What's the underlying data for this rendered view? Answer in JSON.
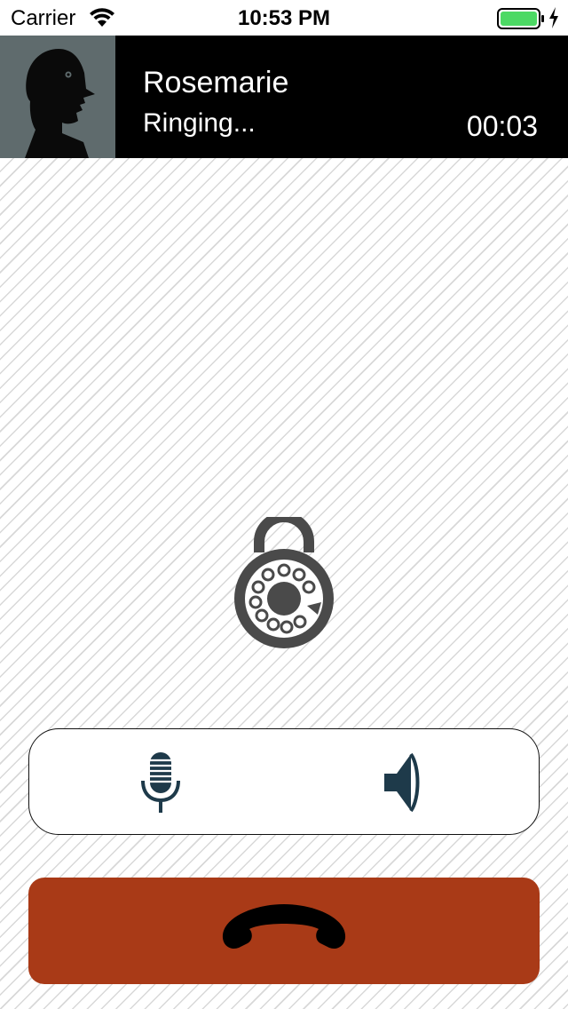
{
  "status_bar": {
    "carrier": "Carrier",
    "time": "10:53 PM",
    "battery_color": "#4cd964"
  },
  "call": {
    "caller_name": "Rosemarie",
    "status": "Ringing...",
    "timer": "00:03"
  },
  "icons": {
    "avatar": "silhouette-avatar",
    "center": "rotary-padlock-icon",
    "mute": "microphone-icon",
    "speaker": "speaker-icon",
    "end_call": "phone-handset-icon"
  },
  "colors": {
    "header_bg": "#000000",
    "icon_color": "#1e3a4a",
    "end_call_bg": "#a93a17",
    "lock_color": "#4a4a4a"
  }
}
